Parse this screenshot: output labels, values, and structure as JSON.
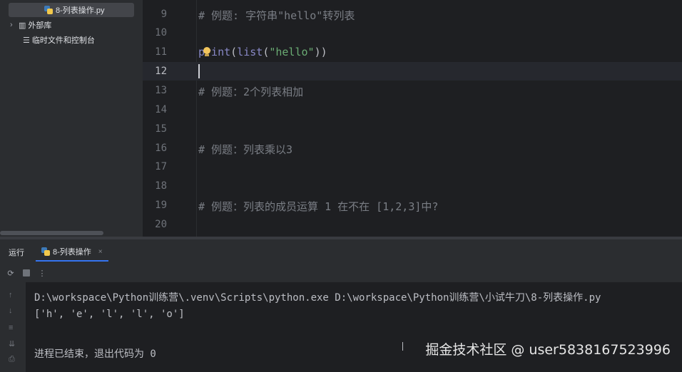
{
  "project_panel": {
    "items": [
      {
        "label": "8-列表操作.py",
        "icon": "python-file-icon"
      },
      {
        "label": "外部库",
        "icon": "library-icon"
      },
      {
        "label": "临时文件和控制台",
        "icon": "scratches-icon"
      }
    ]
  },
  "editor": {
    "lines": [
      {
        "num": "9",
        "text": "# 例题: 字符串\"hello\"转列表"
      },
      {
        "num": "10",
        "text": ""
      },
      {
        "num": "11",
        "text": "print(list(\"hello\"))"
      },
      {
        "num": "12",
        "text": ""
      },
      {
        "num": "13",
        "text": "# 例题：2个列表相加"
      },
      {
        "num": "14",
        "text": ""
      },
      {
        "num": "15",
        "text": ""
      },
      {
        "num": "16",
        "text": "# 例题：列表乘以3"
      },
      {
        "num": "17",
        "text": ""
      },
      {
        "num": "18",
        "text": ""
      },
      {
        "num": "19",
        "text": "# 例题：列表的成员运算 1 在不在 [1,2,3]中?"
      },
      {
        "num": "20",
        "text": ""
      }
    ],
    "current_line": "12"
  },
  "run_panel": {
    "title": "运行",
    "tab_label": "8-列表操作",
    "tab_close": "×",
    "console_lines": [
      "D:\\workspace\\Python训练营\\.venv\\Scripts\\python.exe D:\\workspace\\Python训练营\\小试牛刀\\8-列表操作.py",
      "['h', 'e', 'l', 'l', 'o']",
      "",
      "进程已结束，退出代码为 0"
    ]
  },
  "watermark": "掘金技术社区 @ user5838167523996",
  "colors": {
    "editor_bg": "#1e1f22",
    "panel_bg": "#2b2d30",
    "comment": "#7a7e85",
    "string": "#6aab73",
    "accent": "#3574f0"
  }
}
